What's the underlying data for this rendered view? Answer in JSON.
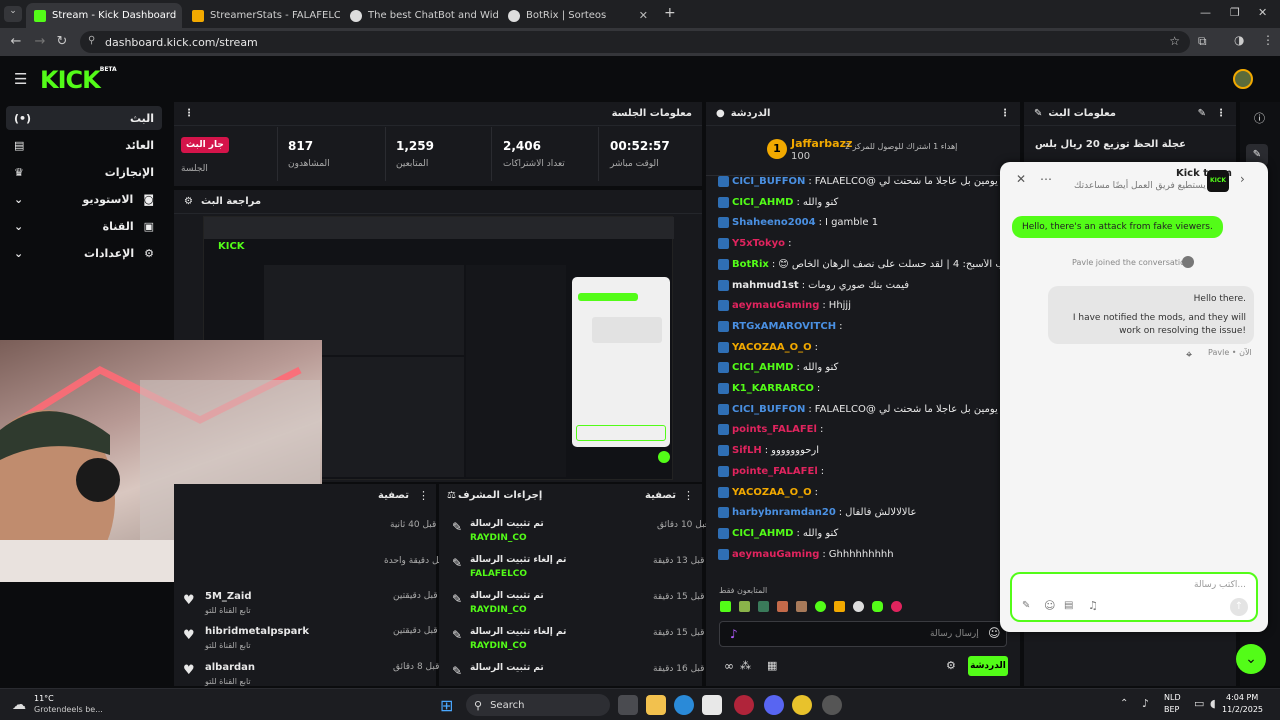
{
  "browser": {
    "tabs": [
      {
        "title": "Stream - Kick Dashboard",
        "fav_color": "#53fc18"
      },
      {
        "title": "StreamerStats - FALAFELCO Pro",
        "fav_color": "#f2a900"
      },
      {
        "title": "The best ChatBot and Widgets",
        "fav_color": "#dddddd"
      },
      {
        "title": "BotRix | Sorteos",
        "fav_color": "#dddddd"
      }
    ],
    "url": "dashboard.kick.com/stream"
  },
  "kick": {
    "logo": "KICK",
    "beta": "BETA"
  },
  "sidebar": {
    "items": [
      {
        "label": "البث",
        "icon": "(•)"
      },
      {
        "label": "العائد",
        "icon": "▤"
      },
      {
        "label": "الإنجازات",
        "icon": "🏆"
      },
      {
        "label": "الاستوديو",
        "icon": "◙"
      },
      {
        "label": "القناة",
        "icon": "▣"
      },
      {
        "label": "الإعدادات",
        "icon": "⚙"
      }
    ]
  },
  "session": {
    "title": "معلومات الجلسة",
    "live_badge": "جار البث",
    "session_label": "الجلسة",
    "stats": [
      {
        "value": "817",
        "label": "المشاهدون"
      },
      {
        "value": "1,259",
        "label": "المتابعين"
      },
      {
        "value": "2,406",
        "label": "تعداد الاشتراكات"
      },
      {
        "value": "00:52:57",
        "label": "الوقت مباشر"
      }
    ]
  },
  "preview": {
    "title": "مراجعة البث"
  },
  "chat": {
    "title": "الدردشة",
    "top": {
      "name": "Jaffarbazz",
      "amount": "100",
      "rank": "1",
      "goal": "إهداء 1 اشتراك للوصول للمركز 2"
    },
    "messages": [
      {
        "user": "CICI_BUFFON",
        "color": "#4a90e2",
        "text": "انا ربحت قبل يومين بل عاجلا ما شحنت لي @FALAELCO"
      },
      {
        "user": "CICI_AHMD",
        "color": "#53fc18",
        "text": "كنو والله"
      },
      {
        "user": "Shaheeno2004",
        "color": "#4a90e2",
        "text": "I gamble 1"
      },
      {
        "user": "Y5xTokyo",
        "color": "#e0245e",
        "text": ""
      },
      {
        "user": "BotRix",
        "color": "#53fc18",
        "text": "@Shaheeno2004 نتيجة لقالب الأسبح: 4 | لقد حسلت على نصف الرهان الخاص 😊"
      },
      {
        "user": "mahmud1st",
        "color": "#e8e8e8",
        "text": "فيمت بنك صوري رومات"
      },
      {
        "user": "aeymauGaming",
        "color": "#e0245e",
        "text": "Hhjjj"
      },
      {
        "user": "RTGxAMAROVITCH",
        "color": "#4a90e2",
        "text": ""
      },
      {
        "user": "YACOZAA_O_O",
        "color": "#f2a900",
        "text": ""
      },
      {
        "user": "CICI_AHMD",
        "color": "#53fc18",
        "text": "كنو والله"
      },
      {
        "user": "K1_KARRARCO",
        "color": "#53fc18",
        "text": ""
      },
      {
        "user": "CICI_BUFFON",
        "color": "#4a90e2",
        "text": "انا ربحت قبل يومين بل عاجلا ما شحنت لي @FALAELCO"
      },
      {
        "user": "points_FALAFEl",
        "color": "#e0245e",
        "text": ""
      },
      {
        "user": "SifLH",
        "color": "#e0245e",
        "text": "ارحووووووو"
      },
      {
        "user": "pointe_FALAFEl",
        "color": "#e0245e",
        "text": ""
      },
      {
        "user": "YACOZAA_O_O",
        "color": "#f2a900",
        "text": ""
      },
      {
        "user": "harbybnramdan20",
        "color": "#4a90e2",
        "text": "عالالالالش فالفال"
      },
      {
        "user": "CICI_AHMD",
        "color": "#53fc18",
        "text": "كنو والله"
      },
      {
        "user": "aeymauGaming",
        "color": "#e0245e",
        "text": "Ghhhhhhhhh"
      }
    ],
    "followers_label": "المتابعون فقط",
    "input_placeholder": "إرسال رسالة",
    "send_label": "الدردشة"
  },
  "info": {
    "title": "معلومات البث",
    "stream_title": "عجلة الحظ توزيع 20 ريال بلس"
  },
  "activity": {
    "title": "تصفية",
    "items": [
      {
        "name": "",
        "sub": "",
        "time": "قبل 40 ثانية"
      },
      {
        "name": "",
        "sub": "",
        "time": "قبل دقيقة واحدة"
      },
      {
        "name": "5M_Zaid",
        "sub": "تابع القناة للتو",
        "time": "قبل دقيقتين"
      },
      {
        "name": "hibridmetalpspark",
        "sub": "تابع القناة للتو",
        "time": "قبل دقيقتين"
      },
      {
        "name": "albardan",
        "sub": "تابع القناة للتو",
        "time": "قبل 8 دقائق"
      }
    ]
  },
  "modactions": {
    "title": "إجراءات المشرف",
    "filter": "تصفية",
    "items": [
      {
        "action": "تم تثبيت الرسالة",
        "by": "RAYDIN_CO",
        "prefix": "من قبل",
        "time": "قبل 10 دقائق"
      },
      {
        "action": "تم إلغاء تثبيت الرسالة",
        "by": "FALAFELCO",
        "prefix": "من قبل",
        "time": "قبل 13 دقيقة"
      },
      {
        "action": "تم تثبيت الرسالة",
        "by": "RAYDIN_CO",
        "prefix": "من قبل",
        "time": "قبل 15 دقيقة"
      },
      {
        "action": "تم إلغاء تثبيت الرسالة",
        "by": "RAYDIN_CO",
        "prefix": "من قبل",
        "time": "قبل 15 دقيقة"
      },
      {
        "action": "تم تثبيت الرسالة",
        "by": "RAYDIN_CO",
        "prefix": "من قبل",
        "time": "قبل 16 دقيقة"
      }
    ]
  },
  "support": {
    "team": "Kick team",
    "subtitle": "يستطيع فريق العمل أيضًا مساعدتك",
    "user_msg": "Hello, there's an attack from fake viewers.",
    "joined": "Pavle joined the conversation",
    "reply_line1": "Hello there.",
    "reply_line2": "I have notified the mods, and they will work on resolving the issue!",
    "meta": "Pavle • الآن",
    "placeholder": "اكتب رسالة..."
  },
  "taskbar": {
    "weather_temp": "11°C",
    "weather_desc": "Grotendeels be...",
    "search": "Search",
    "lang1": "NLD",
    "lang2": "BEP",
    "time": "4:04 PM",
    "date": "11/2/2025"
  }
}
